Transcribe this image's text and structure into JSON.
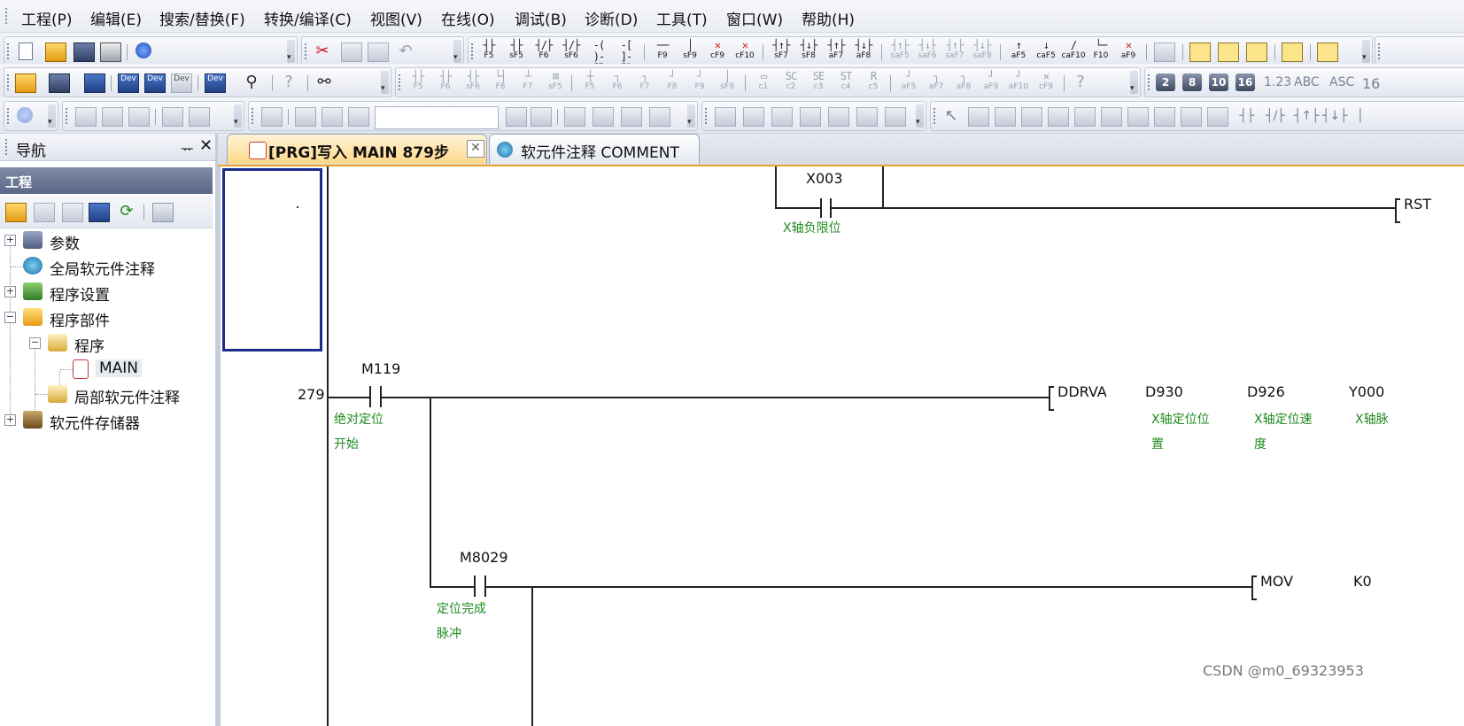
{
  "menu": [
    "工程(P)",
    "编辑(E)",
    "搜索/替换(F)",
    "转换/编译(C)",
    "视图(V)",
    "在线(O)",
    "调试(B)",
    "诊断(D)",
    "工具(T)",
    "窗口(W)",
    "帮助(H)"
  ],
  "toolbar": {
    "ladder_keys": [
      "F5",
      "sF5",
      "F6",
      "sF6",
      "F7",
      "F8",
      "F9",
      "sF9",
      "cF9",
      "cF10",
      "sF7",
      "sF8",
      "aF7",
      "aF8",
      "saF5",
      "saF6",
      "saF7",
      "saF8",
      "aF5",
      "caF5",
      "caF10",
      "F10",
      "aF9"
    ],
    "ladder_keys_row2": [
      "F5",
      "F6",
      "sF6",
      "F8",
      "F7",
      "sF5",
      "F5",
      "F6",
      "F7",
      "F8",
      "F9",
      "sF9",
      "c1",
      "c2",
      "c3",
      "c4",
      "c5",
      "aF5",
      "aF7",
      "aF8",
      "aF9",
      "aF10",
      "cF9"
    ],
    "device_labels": [
      "Dev",
      "Dev",
      "Dev",
      "Dev"
    ],
    "number_buttons": [
      "2",
      "8",
      "10",
      "16"
    ],
    "text_buttons": [
      "1.23",
      "ABC",
      "ASC",
      "16"
    ]
  },
  "nav": {
    "title": "导航",
    "pin": "ᅲ",
    "close": "✕",
    "project_label": "工程",
    "tree": [
      {
        "label": "参数",
        "level": 0,
        "expander": "+"
      },
      {
        "label": "全局软元件注释",
        "level": 0,
        "expander": ""
      },
      {
        "label": "程序设置",
        "level": 0,
        "expander": "+"
      },
      {
        "label": "程序部件",
        "level": 0,
        "expander": "−"
      },
      {
        "label": "程序",
        "level": 1,
        "expander": "−"
      },
      {
        "label": "MAIN",
        "level": 2,
        "expander": ""
      },
      {
        "label": "局部软元件注释",
        "level": 1,
        "expander": ""
      },
      {
        "label": "软元件存储器",
        "level": 0,
        "expander": "+"
      }
    ]
  },
  "tabs": {
    "main": "[PRG]写入 MAIN 879步",
    "comment": "软元件注释 COMMENT",
    "close": "✕"
  },
  "ladder": {
    "rung1": {
      "contact": "X003",
      "contact_comment": "X轴负限位",
      "instruction": "RST"
    },
    "rung2": {
      "step": "279",
      "contact": "M119",
      "contact_comment": [
        "绝对定位",
        "开始"
      ],
      "instruction": "DDRVA",
      "operands": [
        "D930",
        "D926",
        "Y000"
      ],
      "operand_comments": [
        [
          "X轴定位位",
          "置"
        ],
        [
          "X轴定位速",
          "度"
        ],
        [
          "X轴脉"
        ]
      ]
    },
    "rung3": {
      "contact": "M8029",
      "contact_comment": [
        "定位完成",
        "脉冲"
      ],
      "instruction": "MOV",
      "operands": [
        "K0"
      ]
    }
  },
  "watermark": "CSDN @m0_69323953",
  "colors": {
    "comment": "#1f8a1f",
    "cursor": "#1a2c8c",
    "tab_active_top": "#fff3d6",
    "tab_underline": "#f0a02a"
  }
}
